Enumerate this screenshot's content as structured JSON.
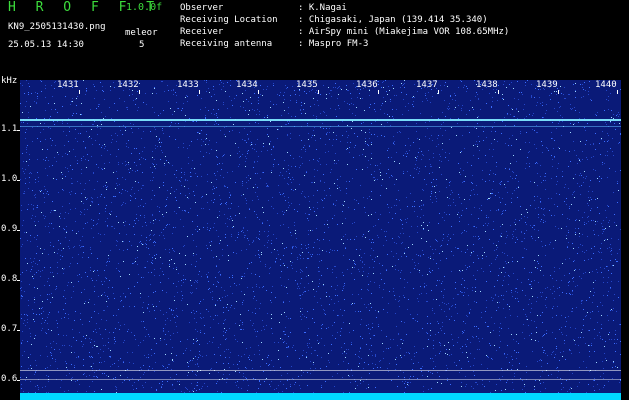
{
  "header": {
    "title": "H R O F F T",
    "version": "1.0.0f",
    "filename": "KN9_2505131430.png",
    "datetime": "25.05.13 14:30",
    "meteor_label": "meleor",
    "meteor_count": "5",
    "info_labels": [
      "Observer",
      "Receiving Location",
      "Receiver",
      "Receiving antenna"
    ],
    "info_values": [
      ": K.Nagai",
      ": Chigasaki, Japan (139.414 35.340)",
      ": AirSpy mini (Miakejima VOR 108.65MHz)",
      ": Maspro FM-3"
    ]
  },
  "plot": {
    "y_unit": "kHz",
    "y_ticks": [
      "1.1",
      "1.0",
      "0.9",
      "0.8",
      "0.7",
      "0.6"
    ],
    "x_ticks": [
      "1431",
      "1432",
      "1433",
      "1434",
      "1435",
      "1436",
      "1437",
      "1438",
      "1439",
      "1440"
    ],
    "colors": {
      "background": "#0a1a78",
      "noise": "#3a6cff",
      "carrier": "#7fe8ff",
      "baseline": "#00d8ff"
    }
  }
}
